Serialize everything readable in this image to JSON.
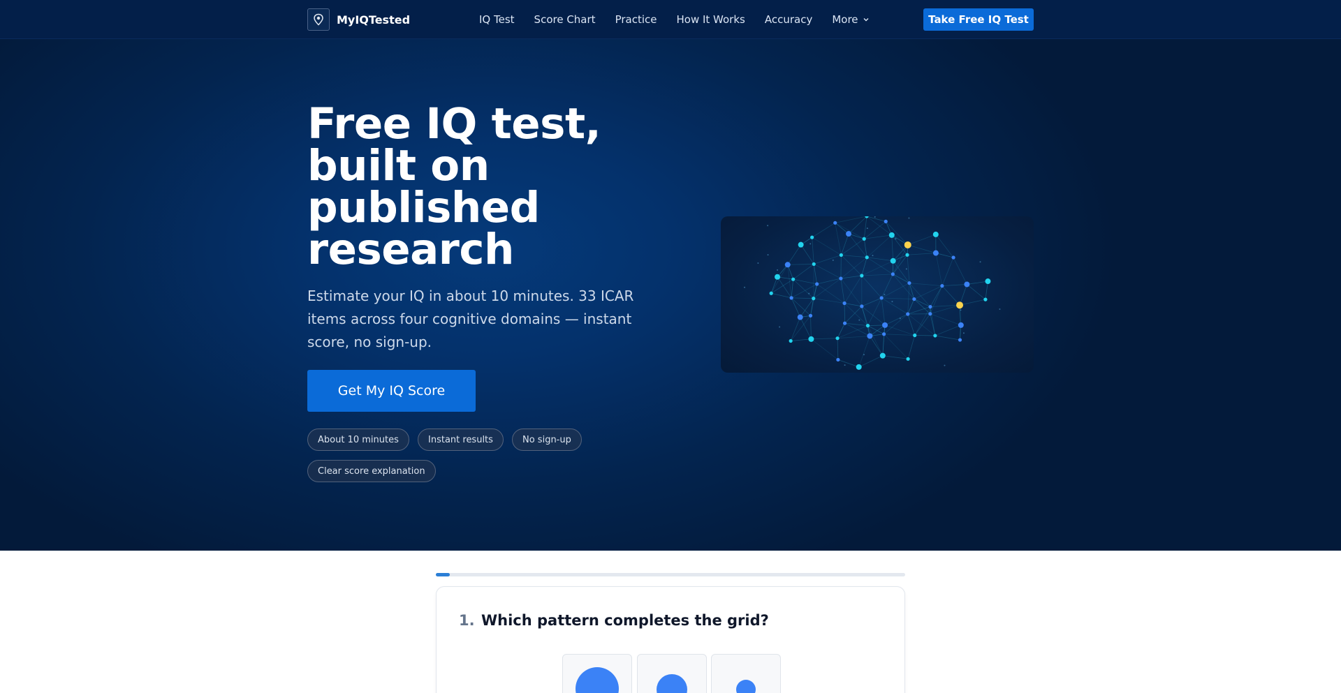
{
  "brand": {
    "name": "MyIQTested"
  },
  "nav": {
    "links": [
      "IQ Test",
      "Score Chart",
      "Practice",
      "How It Works",
      "Accuracy",
      "More"
    ],
    "cta": "Take Free IQ Test"
  },
  "hero": {
    "title": "Free IQ test, built on published research",
    "subtitle": "Estimate your IQ in about 10 minutes. 33 ICAR items across four cognitive domains — instant score, no sign-up.",
    "cta": "Get My IQ Score",
    "chips": [
      "About 10 minutes",
      "Instant results",
      "No sign-up",
      "Clear score explanation"
    ]
  },
  "quiz": {
    "progress": 0.03,
    "question_number": "1.",
    "question_text": "Which pattern completes the grid?"
  },
  "colors": {
    "nav_bg": "#031f49",
    "accent": "#0b6bd8",
    "node": "#22d3ee",
    "highlight": "#fcd34d"
  },
  "icons": {
    "brand": "brain-pin-icon",
    "more": "chevron-down-icon"
  }
}
